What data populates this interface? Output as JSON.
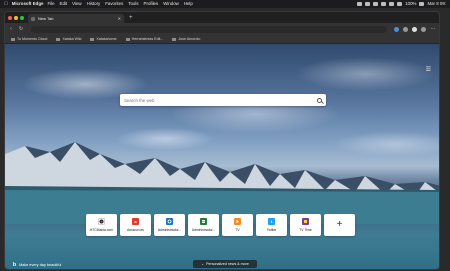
{
  "menubar": {
    "app_name": "Microsoft Edge",
    "items": [
      "File",
      "Edit",
      "View",
      "History",
      "Favorites",
      "Tools",
      "Profiles",
      "Window",
      "Help"
    ],
    "battery": "100%",
    "time": "Mar 8 09:"
  },
  "tab": {
    "label": "New Tab"
  },
  "favorites": [
    {
      "label": "Tu Momento Cloud"
    },
    {
      "label": "Xataka Wiki"
    },
    {
      "label": "Xatakahome"
    },
    {
      "label": "Herramientas Edit..."
    },
    {
      "label": "Jose Amoroto"
    }
  ],
  "search": {
    "placeholder": "Search the web"
  },
  "tiles": [
    {
      "label": "HTCMania.com",
      "icon": "htcmania-icon",
      "color": "#ffffff",
      "glyph": ""
    },
    {
      "label": "Amazon.es",
      "icon": "amazon-icon",
      "color": "#e03a2f",
      "glyph": "a"
    },
    {
      "label": "Administrador...",
      "icon": "admin-icon",
      "color": "#1a73c8",
      "glyph": ""
    },
    {
      "label": "Administrador...",
      "icon": "sheets-icon",
      "color": "#1e7e34",
      "glyph": ""
    },
    {
      "label": "TV",
      "icon": "tv-icon",
      "color": "#f28c28",
      "glyph": ""
    },
    {
      "label": "Twitter",
      "icon": "twitter-icon",
      "color": "#1da1f2",
      "glyph": "t"
    },
    {
      "label": "TV Time",
      "icon": "tvtime-icon",
      "color": "#7c3aa6",
      "glyph": ""
    }
  ],
  "bing": {
    "logo": "b",
    "caption": "Make every day beautiful"
  },
  "personalized": {
    "label": "Personalized news & more"
  }
}
